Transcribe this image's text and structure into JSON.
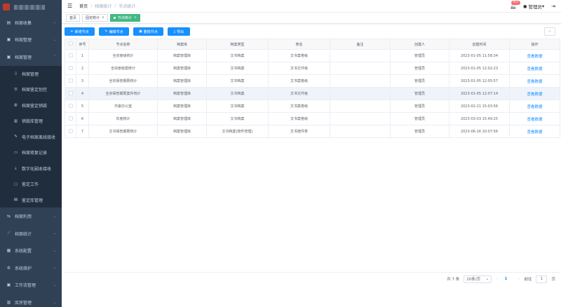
{
  "sidebar": {
    "menu": [
      {
        "label": "档案收集",
        "icon": "folder-icon"
      },
      {
        "label": "档案整理",
        "icon": "archive-icon"
      },
      {
        "label": "档案管理",
        "icon": "archive-box-icon"
      }
    ],
    "sub": [
      {
        "label": "档案管理",
        "icon": "document-icon"
      },
      {
        "label": "档案鉴定划控",
        "icon": "list-icon"
      },
      {
        "label": "档案鉴定销毁",
        "icon": "trash-icon"
      },
      {
        "label": "销毁库管理",
        "icon": "bin-icon"
      },
      {
        "label": "电子档案离线接收",
        "icon": "pen-icon"
      },
      {
        "label": "档案修复记录",
        "icon": "record-icon"
      },
      {
        "label": "数字化副本接收",
        "icon": "download-icon"
      },
      {
        "label": "鉴定工作",
        "icon": "task-icon"
      },
      {
        "label": "鉴定库管理",
        "icon": "library-icon"
      }
    ],
    "menu2": [
      {
        "label": "档案利用",
        "icon": "share-icon"
      },
      {
        "label": "档案统计",
        "icon": "chart-icon"
      },
      {
        "label": "系统配置",
        "icon": "config-icon"
      },
      {
        "label": "系统维护",
        "icon": "gear-icon"
      },
      {
        "label": "工作流管理",
        "icon": "workflow-icon"
      },
      {
        "label": "库房管理",
        "icon": "warehouse-icon"
      }
    ]
  },
  "navbar": {
    "breadcrumb": [
      "首页",
      "档案统计",
      "节点统计"
    ],
    "badge": "457",
    "user": "管理员"
  },
  "tags": [
    {
      "label": "首页"
    },
    {
      "label": "固定统计"
    },
    {
      "label": "节点统计"
    }
  ],
  "toolbar": {
    "add": "新增节点",
    "edit": "编辑节点",
    "delete": "删除节点",
    "export": "导出"
  },
  "table": {
    "headers": [
      "序号",
      "节点名称",
      "档案库",
      "档案类型",
      "表名",
      "备注",
      "创建人",
      "创建时间",
      "操作"
    ],
    "rows": [
      [
        "1",
        "全宗册级统计",
        "档案管理库",
        "文书档案",
        "文书案卷级",
        "",
        "管理员",
        "2023-01-05 11:58:34",
        "查看数据"
      ],
      [
        "2",
        "全宗册级案统计",
        "档案管理库",
        "文书档案",
        "文书文件级",
        "",
        "管理员",
        "2023-01-05 12:02:23",
        "查看数据"
      ],
      [
        "3",
        "全宗保管期限统计",
        "档案管理库",
        "文书档案",
        "文书案卷级",
        "",
        "管理员",
        "2023-01-05 12:05:57",
        "查看数据"
      ],
      [
        "4",
        "全宗保管期限案件统计",
        "档案管理库",
        "文书档案",
        "文书文件级",
        "",
        "管理员",
        "2023-01-05 12:07:14",
        "查看数据"
      ],
      [
        "5",
        "市委办公室",
        "档案管理库",
        "文书档案",
        "文书案卷级",
        "",
        "管理员",
        "2023-02-21 15:03:56",
        "查看数据"
      ],
      [
        "6",
        "年度统计",
        "档案管理库",
        "文书档案",
        "文书案卷级",
        "",
        "管理员",
        "2023-03-03 15:49:25",
        "查看数据"
      ],
      [
        "7",
        "文书保管期限统计",
        "档案管理库",
        "文书档案(按件管理)",
        "文书按件表",
        "",
        "管理员",
        "2023-06-16 20:07:56",
        "查看数据"
      ]
    ]
  },
  "pager": {
    "total": "共 7 条",
    "size": "20条/页",
    "current": "1",
    "goto": "前往",
    "goto_value": "1",
    "page_unit": "页"
  }
}
